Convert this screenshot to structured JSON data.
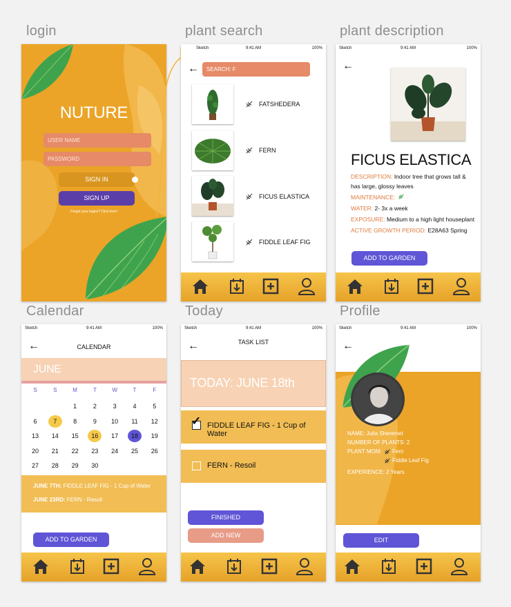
{
  "labels": {
    "login": "login",
    "plant_search": "plant search",
    "plant_description": "plant description",
    "calendar": "Calendar",
    "today": "Today",
    "profile": "Profile"
  },
  "status": {
    "carrier": "Sketch",
    "time": "9:41 AM",
    "battery": "100%"
  },
  "colors": {
    "orange": "#eba427",
    "salmon": "#e68a67",
    "purple": "#5f55d6",
    "peach": "#f7d2b4",
    "nav": "#f0b23a"
  },
  "login": {
    "title": "NUTURE",
    "username_placeholder": "USER NAME",
    "password_placeholder": "PASSWORD",
    "sign_in": "SIGN IN",
    "sign_up": "SIGN UP",
    "forgot": "Forgot your logins? Click here!"
  },
  "search": {
    "query": "SEARCH:  F",
    "results": [
      {
        "name": "FATSHEDERA"
      },
      {
        "name": "FERN"
      },
      {
        "name": "FICUS ELASTICA"
      },
      {
        "name": "FIDDLE LEAF FIG"
      }
    ]
  },
  "description": {
    "title": "FICUS ELASTICA",
    "description_key": "DESCRIPTION:",
    "description_val": " Indoor tree that grows tall & has large, glossy leaves",
    "maintenance_key": "MAINTENANCE:",
    "water_key": "WATER:",
    "water_val": " 2- 3x a week",
    "exposure_key": "EXPOSURE:",
    "exposure_val": " Medium to a high light houseplant",
    "growth_key": "ACTIVE GROWTH PERIOD:",
    "growth_val": " E28A63 Spring",
    "add_button": "ADD TO GARDEN"
  },
  "calendar": {
    "title": "CALENDAR",
    "month": "JUNE",
    "weekdays": [
      "S",
      "S",
      "M",
      "T",
      "W",
      "T",
      "F"
    ],
    "weeks": [
      [
        "",
        "",
        "1",
        "2",
        "3",
        "4",
        "5"
      ],
      [
        "6",
        "7",
        "8",
        "9",
        "10",
        "11",
        "12"
      ],
      [
        "13",
        "14",
        "15",
        "16",
        "17",
        "18",
        "19"
      ],
      [
        "20",
        "21",
        "22",
        "23",
        "24",
        "25",
        "26"
      ],
      [
        "27",
        "28",
        "29",
        "30",
        "",
        "",
        ""
      ]
    ],
    "highlight_yellow": [
      "7",
      "16"
    ],
    "highlight_purple": [
      "18"
    ],
    "events": [
      {
        "date": "JUNE 7TH:",
        "task": " FIDDLE LEAF FIG - 1 Cup of Water"
      },
      {
        "date": "JUNE 23RD:",
        "task": " FERN - Resoil"
      }
    ],
    "add_button": "ADD TO GARDEN"
  },
  "today": {
    "title": "TASK LIST",
    "heading": "TODAY: JUNE 18th",
    "tasks": [
      {
        "label": "FIDDLE LEAF FIG - 1 Cup of Water",
        "checked": true
      },
      {
        "label": "FERN - Resoil",
        "checked": false
      }
    ],
    "finished": "FINISHED",
    "add_new": "ADD NEW"
  },
  "profile": {
    "name": "NAME:  Julia Sheremet",
    "plants": "NUMBER OF PLANTS: 2",
    "plant_mom": "PLANT MOM:",
    "mom_plants": [
      "Fern",
      "Fiddle Leaf Fig"
    ],
    "experience": "EXPERIENCE: 2 Years",
    "edit": "EDIT"
  }
}
